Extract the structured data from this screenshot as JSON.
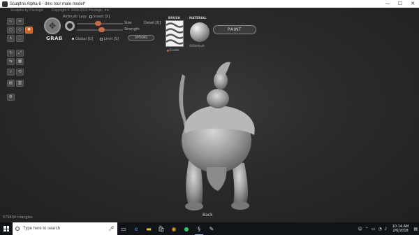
{
  "window": {
    "title": "Sculptris Alpha 6 - dino tour male model*",
    "minimize": "—",
    "maximize": "☐",
    "close": "✕"
  },
  "credits": {
    "left": "Sculptris by Pixologic",
    "right": "Copyright © 2009-2010 Pixologic, Inc."
  },
  "tools": {
    "grab_label": "GRAB",
    "airbrush_label": "Airbrush",
    "lazy_label": "Lazy",
    "invert_label": "Invert [X]",
    "size_label": "Size",
    "strength_label": "Strength",
    "detail_label": "Detail [Q]",
    "options_label": "OPTIONS",
    "global_label": "Global [G]",
    "limit_label": "Limit [S]",
    "size_level": 0.45,
    "strength_level": 0.55
  },
  "brush": {
    "header": "BRUSH",
    "enable_label": "Enable"
  },
  "material": {
    "header": "MATERIAL",
    "name": "SSSdefault"
  },
  "paint_button": "PAINT",
  "status": {
    "triangles": "579434 triangles",
    "view": "Back"
  },
  "taskbar": {
    "search_placeholder": "Type here to search",
    "time": "10:14 AM",
    "date": "2/6/2018"
  },
  "colors": {
    "accent": "#c8642a",
    "knob": "#c96a4a",
    "taskbar": "#101418"
  }
}
